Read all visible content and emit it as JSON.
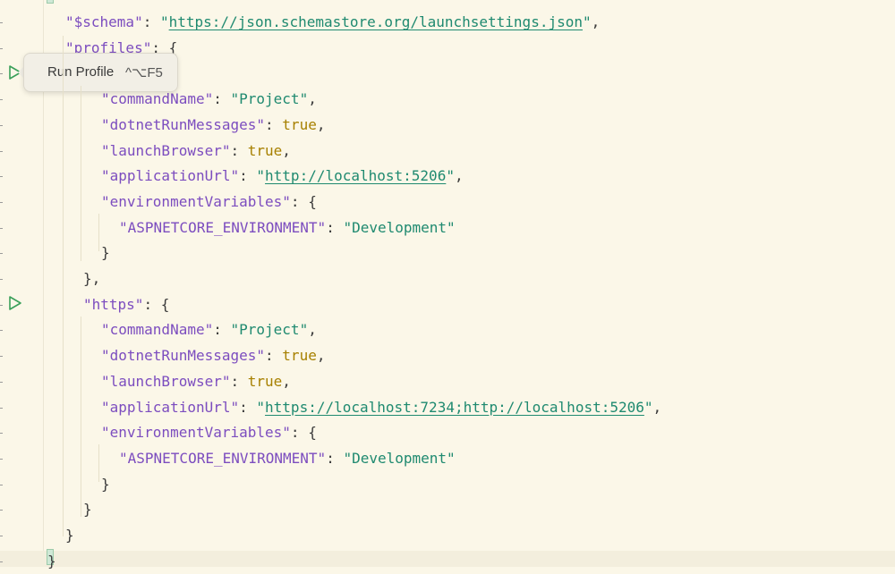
{
  "editor": {
    "lines": [
      {
        "tokens": [
          {
            "t": "key",
            "v": "\"$schema\""
          },
          {
            "t": "punct",
            "v": ": "
          },
          {
            "t": "str",
            "v": "\""
          },
          {
            "t": "url",
            "v": "https://json.schemastore.org/launchsettings.json"
          },
          {
            "t": "str",
            "v": "\""
          },
          {
            "t": "punct",
            "v": ","
          }
        ]
      },
      {
        "tokens": [
          {
            "t": "key",
            "v": "\"profiles\""
          },
          {
            "t": "punct",
            "v": ": {"
          }
        ]
      },
      {
        "tokens": []
      },
      {
        "tokens": [
          {
            "t": "key",
            "v": "\"commandName\""
          },
          {
            "t": "punct",
            "v": ": "
          },
          {
            "t": "str",
            "v": "\"Project\""
          },
          {
            "t": "punct",
            "v": ","
          }
        ]
      },
      {
        "tokens": [
          {
            "t": "key",
            "v": "\"dotnetRunMessages\""
          },
          {
            "t": "punct",
            "v": ": "
          },
          {
            "t": "bool",
            "v": "true"
          },
          {
            "t": "punct",
            "v": ","
          }
        ]
      },
      {
        "tokens": [
          {
            "t": "key",
            "v": "\"launchBrowser\""
          },
          {
            "t": "punct",
            "v": ": "
          },
          {
            "t": "bool",
            "v": "true"
          },
          {
            "t": "punct",
            "v": ","
          }
        ]
      },
      {
        "tokens": [
          {
            "t": "key",
            "v": "\"applicationUrl\""
          },
          {
            "t": "punct",
            "v": ": "
          },
          {
            "t": "str",
            "v": "\""
          },
          {
            "t": "url",
            "v": "http://localhost:5206"
          },
          {
            "t": "str",
            "v": "\""
          },
          {
            "t": "punct",
            "v": ","
          }
        ]
      },
      {
        "tokens": [
          {
            "t": "key",
            "v": "\"environmentVariables\""
          },
          {
            "t": "punct",
            "v": ": {"
          }
        ]
      },
      {
        "tokens": [
          {
            "t": "key",
            "v": "\"ASPNETCORE_ENVIRONMENT\""
          },
          {
            "t": "punct",
            "v": ": "
          },
          {
            "t": "str",
            "v": "\"Development\""
          }
        ]
      },
      {
        "tokens": [
          {
            "t": "punct",
            "v": "}"
          }
        ]
      },
      {
        "tokens": [
          {
            "t": "punct",
            "v": "},"
          }
        ]
      },
      {
        "tokens": [
          {
            "t": "key",
            "v": "\"https\""
          },
          {
            "t": "punct",
            "v": ": {"
          }
        ]
      },
      {
        "tokens": [
          {
            "t": "key",
            "v": "\"commandName\""
          },
          {
            "t": "punct",
            "v": ": "
          },
          {
            "t": "str",
            "v": "\"Project\""
          },
          {
            "t": "punct",
            "v": ","
          }
        ]
      },
      {
        "tokens": [
          {
            "t": "key",
            "v": "\"dotnetRunMessages\""
          },
          {
            "t": "punct",
            "v": ": "
          },
          {
            "t": "bool",
            "v": "true"
          },
          {
            "t": "punct",
            "v": ","
          }
        ]
      },
      {
        "tokens": [
          {
            "t": "key",
            "v": "\"launchBrowser\""
          },
          {
            "t": "punct",
            "v": ": "
          },
          {
            "t": "bool",
            "v": "true"
          },
          {
            "t": "punct",
            "v": ","
          }
        ]
      },
      {
        "tokens": [
          {
            "t": "key",
            "v": "\"applicationUrl\""
          },
          {
            "t": "punct",
            "v": ": "
          },
          {
            "t": "str",
            "v": "\""
          },
          {
            "t": "url",
            "v": "https://localhost:7234;http://localhost:5206"
          },
          {
            "t": "str",
            "v": "\""
          },
          {
            "t": "punct",
            "v": ","
          }
        ]
      },
      {
        "tokens": [
          {
            "t": "key",
            "v": "\"environmentVariables\""
          },
          {
            "t": "punct",
            "v": ": {"
          }
        ]
      },
      {
        "tokens": [
          {
            "t": "key",
            "v": "\"ASPNETCORE_ENVIRONMENT\""
          },
          {
            "t": "punct",
            "v": ": "
          },
          {
            "t": "str",
            "v": "\"Development\""
          }
        ]
      },
      {
        "tokens": [
          {
            "t": "punct",
            "v": "}"
          }
        ]
      },
      {
        "tokens": [
          {
            "t": "punct",
            "v": "}"
          }
        ]
      },
      {
        "tokens": [
          {
            "t": "punct",
            "v": "}"
          }
        ]
      },
      {
        "tokens": [
          {
            "t": "punct",
            "v": "}"
          }
        ]
      }
    ]
  },
  "gutter": {
    "run_icons": [
      "run-profile-icon",
      "run-profile-icon"
    ]
  },
  "tooltip": {
    "label": "Run Profile",
    "shortcut": "^⌥F5"
  },
  "colors": {
    "background": "#fbf7e8",
    "key": "#7c4dbf",
    "string": "#1f8a70",
    "boolean": "#a78000",
    "run_icon": "#3aa05a"
  }
}
